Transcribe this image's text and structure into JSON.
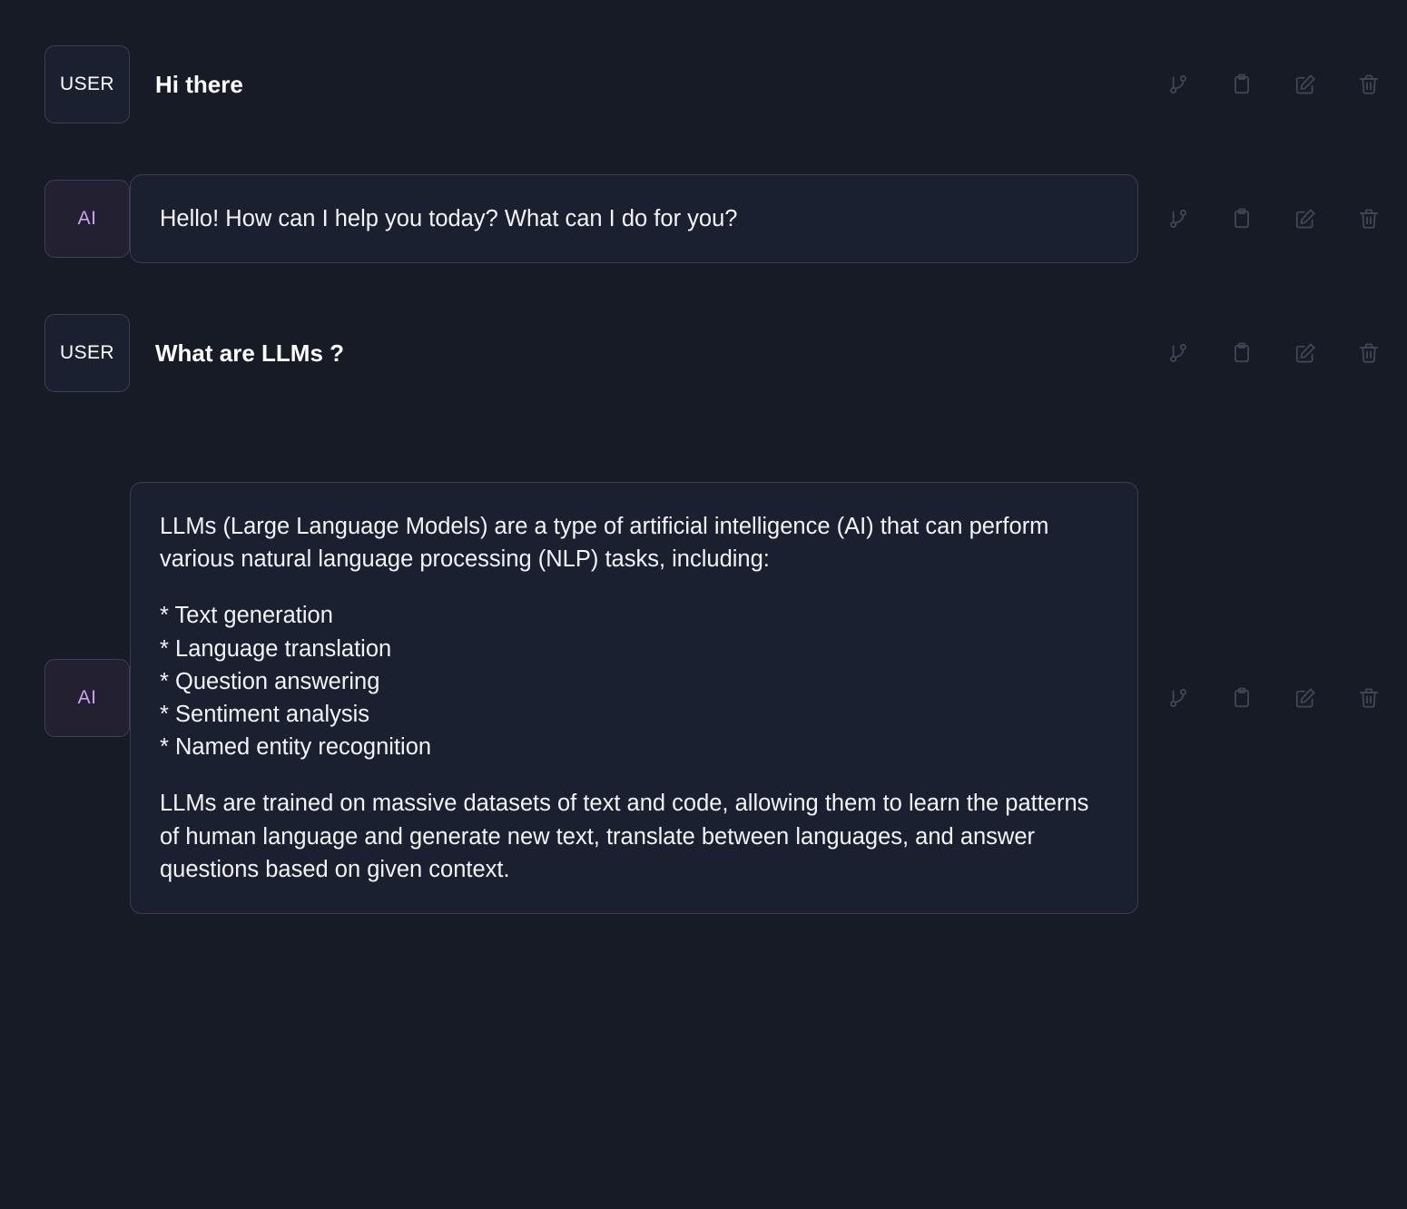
{
  "app": {
    "background_color": "#171b26",
    "bubble_color": "#1b2030",
    "bubble_border_color": "#3d3a52",
    "ai_accent_color": "#c9a1f7",
    "icon_color": "#3f4656"
  },
  "roles": {
    "user_label": "USER",
    "assistant_label": "AI"
  },
  "actions": {
    "branch_label": "branch",
    "copy_label": "copy",
    "edit_label": "edit",
    "delete_label": "delete"
  },
  "messages": [
    {
      "role": "user",
      "avatar": "USER",
      "style": "plain",
      "text": "Hi there"
    },
    {
      "role": "assistant",
      "avatar": "AI",
      "style": "bubble",
      "text": "Hello! How can I help you today? What can I do for you?"
    },
    {
      "role": "user",
      "avatar": "USER",
      "style": "plain",
      "text": "What are LLMs ?"
    },
    {
      "role": "assistant",
      "avatar": "AI",
      "style": "bubble",
      "intro": "LLMs (Large Language Models) are a type of artificial intelligence (AI) that can perform various natural language processing (NLP) tasks, including:",
      "bullets": [
        "* Text generation",
        "* Language translation",
        "* Question answering",
        "* Sentiment analysis",
        "* Named entity recognition"
      ],
      "outro": "LLMs are trained on massive datasets of text and code, allowing them to learn the patterns of human language and generate new text, translate between languages, and answer questions based on given context."
    }
  ]
}
